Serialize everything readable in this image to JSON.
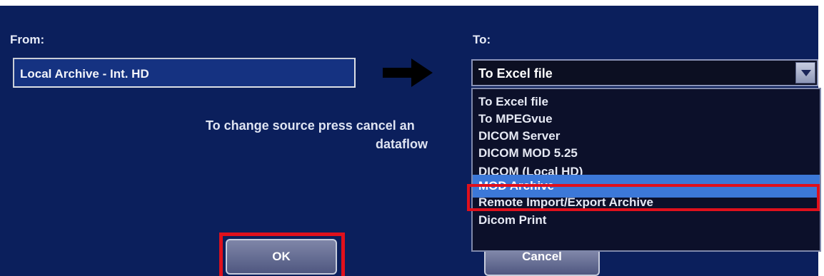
{
  "from": {
    "label": "From:",
    "value": "Local Archive - Int. HD"
  },
  "to": {
    "label": "To:",
    "selected": "To Excel file",
    "options": [
      "To Excel file",
      "To MPEGvue",
      "DICOM Server",
      "DICOM MOD 5.25",
      "DICOM (Local HD)",
      "MOD Archive",
      "Remote Import/Export Archive",
      "Dicom Print"
    ],
    "highlighted": "MOD Archive"
  },
  "message": {
    "line1": "To change source press cancel an",
    "line2": "dataflow"
  },
  "buttons": {
    "ok": "OK",
    "cancel": "Cancel"
  },
  "colors": {
    "background": "#0b1f5c",
    "highlight": "#3c78d8",
    "annotation": "#e0101c"
  }
}
